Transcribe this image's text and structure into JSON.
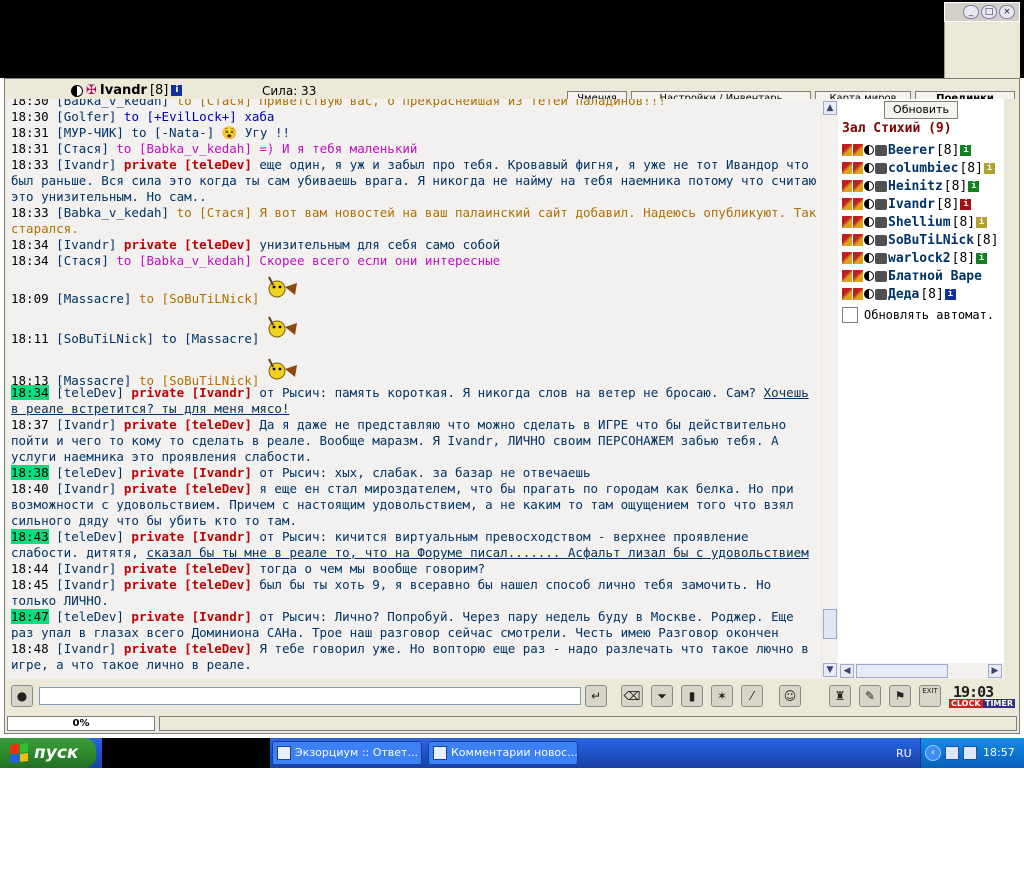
{
  "window": {
    "controls": [
      "_",
      "□",
      "×"
    ]
  },
  "header": {
    "username": "Ivandr",
    "level": "[8]",
    "strength": "Сила: 33",
    "tabs": [
      {
        "label": "Чмения",
        "bold": false
      },
      {
        "label": "Настройки / Инвентарь",
        "bold": false
      },
      {
        "label": "Карта миров",
        "bold": false
      },
      {
        "label": "Поединки",
        "bold": true
      }
    ]
  },
  "chat": {
    "lines": [
      {
        "time": "18:30",
        "parts": [
          {
            "t": "[Babka_v_kedah]",
            "c": "n"
          },
          {
            "t": " to [Стася] Приветствую вас, о прекраснейшая из тетей паладинов!!!",
            "c": "gold"
          }
        ]
      },
      {
        "time": "18:30",
        "parts": [
          {
            "t": "[Golfer]",
            "c": "n"
          },
          {
            "t": " to [+EvilLock+] хаба",
            "c": "blue"
          }
        ]
      },
      {
        "time": "18:31",
        "parts": [
          {
            "t": "[МУР-ЧИК]",
            "c": "n"
          },
          {
            "t": " to [-Nata-] ",
            "c": "n"
          },
          {
            "t": "😵",
            "c": "smiley"
          },
          {
            "t": " Угу !!",
            "c": "n"
          }
        ]
      },
      {
        "time": "18:31",
        "parts": [
          {
            "t": "[Стася]",
            "c": "n"
          },
          {
            "t": " to [Babka_v_kedah] =) И я тебя маленький",
            "c": "pink"
          }
        ]
      },
      {
        "time": "18:33",
        "parts": [
          {
            "t": "[Ivandr]",
            "c": "n"
          },
          {
            "t": " private [teleDev]",
            "c": "pr"
          },
          {
            "t": " еще один, я уж и забыл про тебя. Кровавый фигня, я уже не тот Ивандор что был раньше. Вся сила это когда ты сам убиваешь врага. Я никогда не найму на тебя наемника потому что считаю это унизительным. Но сам..",
            "c": "n"
          }
        ]
      },
      {
        "time": "18:33",
        "parts": [
          {
            "t": "[Babka_v_kedah]",
            "c": "n"
          },
          {
            "t": " to [Стася] Я вот вам новостей на ваш палаинский сайт добавил. Надеюсь опубликуют. Так старался.",
            "c": "gold"
          }
        ]
      },
      {
        "time": "18:34",
        "parts": [
          {
            "t": "[Ivandr]",
            "c": "n"
          },
          {
            "t": " private [teleDev]",
            "c": "pr"
          },
          {
            "t": " унизительным для себя само собой",
            "c": "n"
          }
        ]
      },
      {
        "time": "18:34",
        "parts": [
          {
            "t": "[Стася]",
            "c": "n"
          },
          {
            "t": " to [Babka_v_kedah] Скорее всего если они интересные",
            "c": "pink"
          }
        ]
      },
      {
        "time": "18:09",
        "parts": [
          {
            "t": "[Massacre]",
            "c": "n"
          },
          {
            "t": " to [SoBuTiLNick]",
            "c": "gold"
          }
        ]
      },
      {
        "time": "18:11",
        "parts": [
          {
            "t": "[SoBuTiLNick]",
            "c": "n"
          },
          {
            "t": " to [Massacre]",
            "c": "n"
          }
        ]
      },
      {
        "time": "18:13",
        "parts": [
          {
            "t": "[Massacre]",
            "c": "n"
          },
          {
            "t": " to [SoBuTiLNick]",
            "c": "gold"
          }
        ]
      },
      {
        "time": "18:34",
        "hl": true,
        "parts": [
          {
            "t": "[teleDev]",
            "c": "n"
          },
          {
            "t": " private [Ivandr]",
            "c": "pr"
          },
          {
            "t": " от Рысич: память короткая. Я никогда слов на ветер не бросаю. Сам? ",
            "c": "n"
          },
          {
            "t": "Хочешь в реале встретится? ты для меня мясо!",
            "c": "n ul"
          }
        ]
      },
      {
        "time": "18:37",
        "parts": [
          {
            "t": "[Ivandr]",
            "c": "n"
          },
          {
            "t": " private [teleDev]",
            "c": "pr"
          },
          {
            "t": " Да я даже не представляю что можно сделать в ИГРЕ что бы действительно пойти и чего то кому то сделать в реале. Вообще маразм. Я Ivandr, ЛИЧНО своим ПЕРСОНАЖЕМ забью тебя. А услуги наемника это проявления слабости.",
            "c": "n"
          }
        ]
      },
      {
        "time": "18:38",
        "hl": true,
        "parts": [
          {
            "t": "[teleDev]",
            "c": "n"
          },
          {
            "t": " private [Ivandr]",
            "c": "pr"
          },
          {
            "t": " от Рысич: хых, слабак. за базар не отвечаешь",
            "c": "n"
          }
        ]
      },
      {
        "time": "18:40",
        "parts": [
          {
            "t": "[Ivandr]",
            "c": "n"
          },
          {
            "t": " private [teleDev]",
            "c": "pr"
          },
          {
            "t": " я еще ен стал мироздателем, что бы прагать по городам как белка. Но при возможности с удовольствием. Причем с настоящим удовольствием, а не каким то там ощущением того что взял сильного дяду что бы убить кто то там.",
            "c": "n"
          }
        ]
      },
      {
        "time": "18:43",
        "hl": true,
        "parts": [
          {
            "t": "[teleDev]",
            "c": "n"
          },
          {
            "t": " private [Ivandr]",
            "c": "pr"
          },
          {
            "t": " от Рысич: кичится виртуальным превосходством - верхнее проявление слабости. дитятя, ",
            "c": "n"
          },
          {
            "t": "сказал бы ты мне в реале то, что на Форуме писал....... Асфальт лизал бы с удовольствием",
            "c": "n ul"
          }
        ]
      },
      {
        "time": "18:44",
        "parts": [
          {
            "t": "[Ivandr]",
            "c": "n"
          },
          {
            "t": " private [teleDev]",
            "c": "pr"
          },
          {
            "t": " тогда о чем мы вообще говорим?",
            "c": "n"
          }
        ]
      },
      {
        "time": "18:45",
        "parts": [
          {
            "t": "[Ivandr]",
            "c": "n"
          },
          {
            "t": " private [teleDev]",
            "c": "pr"
          },
          {
            "t": " был бы ты хоть 9, я всеравно бы нашел способ лично тебя замочить. Но только ЛИЧНО.",
            "c": "n"
          }
        ]
      },
      {
        "time": "18:47",
        "hl": true,
        "parts": [
          {
            "t": "[teleDev]",
            "c": "n"
          },
          {
            "t": " private [Ivandr]",
            "c": "pr"
          },
          {
            "t": " от Рысич: Лично? Попробуй. Через пару недель буду в Москве. Роджер. Еще раз упал в глазах всего Доминиона САНа. Трое наш разговор сейчас смотрели. Честь имею Разговор окончен",
            "c": "n"
          }
        ]
      },
      {
        "time": "18:48",
        "parts": [
          {
            "t": "[Ivandr]",
            "c": "n"
          },
          {
            "t": " private [teleDev]",
            "c": "pr"
          },
          {
            "t": " Я тебе говорил уже. Но вопторю еще раз - надо разлечать что такое лючно в игре, а что такое лично в реале.",
            "c": "n"
          }
        ]
      }
    ]
  },
  "sidebar": {
    "refresh_label": "Обновить",
    "room_title": "Зал Стихий (9)",
    "users": [
      {
        "name": "Beerer",
        "level": "[8]",
        "info": "green"
      },
      {
        "name": "columbiec",
        "level": "[8]",
        "info": "yellow"
      },
      {
        "name": "Heinitz",
        "level": "[8]",
        "info": "green"
      },
      {
        "name": "Ivandr",
        "level": "[8]",
        "info": "red"
      },
      {
        "name": "Shellium",
        "level": "[8]",
        "info": "yellow"
      },
      {
        "name": "SoBuTiLNick",
        "level": "[8]",
        "info": "none"
      },
      {
        "name": "warlock2",
        "level": "[8]",
        "info": "green"
      },
      {
        "name": "Блатной Варе",
        "level": "",
        "info": "none"
      },
      {
        "name": "Деда",
        "level": "[8]",
        "info": "blue"
      }
    ],
    "auto_refresh_label": "Обновлять автомат."
  },
  "toolbar": {
    "clock_time": "19:03",
    "clock_label": "CLOCK",
    "timer_label": "TIMER",
    "exit_label": "EXIT"
  },
  "status": {
    "progress": "0%",
    "progress_value": 0
  },
  "taskbar": {
    "start_label": "пуск",
    "tasks": [
      {
        "label": "Экзорциум :: Ответ..."
      },
      {
        "label": "Комментарии новос..."
      }
    ],
    "lang": "RU",
    "time": "18:57"
  },
  "colors": {
    "highlight": "#00e080",
    "private": "#c00000",
    "nick": "#003366",
    "gold": "#b07000",
    "pink": "#c010c0"
  }
}
